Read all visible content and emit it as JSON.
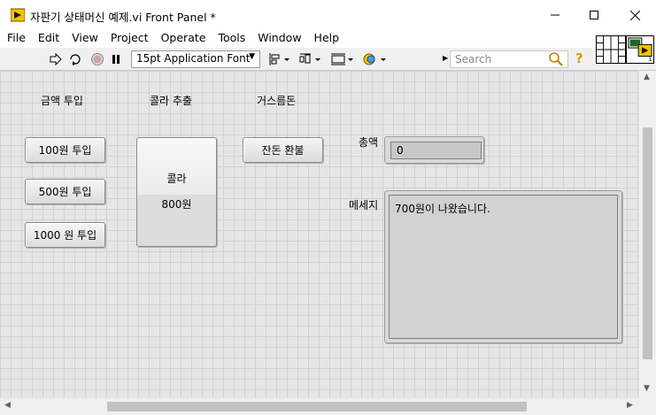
{
  "window": {
    "title": "자판기 상태머신 예제.vi Front Panel *"
  },
  "menu": [
    "File",
    "Edit",
    "View",
    "Project",
    "Operate",
    "Tools",
    "Window",
    "Help"
  ],
  "toolbar": {
    "font": "15pt Application Font",
    "search_placeholder": "Search"
  },
  "panel": {
    "labels": {
      "coin_insert": "금액 투입",
      "cola_dispense": "콜라 추출",
      "change": "거스름돈",
      "total": "총액",
      "message": "메세지"
    },
    "buttons": {
      "insert_100": "100원 투입",
      "insert_500": "500원 투입",
      "insert_1000": "1000 원 투입",
      "cola_name": "콜라",
      "cola_price": "800원",
      "refund": "잔돈  환불"
    },
    "indicators": {
      "total_value": "0",
      "message_value": "700원이 나왔습니다."
    }
  },
  "colors": {
    "panel_bg": "#e6e6e6",
    "grid_line": "#d2d2d2",
    "titlebar_bg": "#ffffff",
    "toolbar_bg": "#f0f0f0"
  }
}
